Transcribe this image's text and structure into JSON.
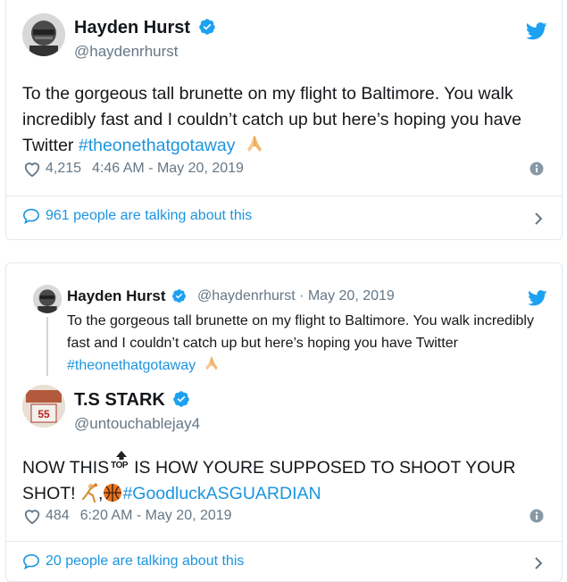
{
  "tweet1": {
    "display_name": "Hayden Hurst",
    "handle": "@haydenrhurst",
    "text_plain": "To the gorgeous tall brunette on my flight to Baltimore. You walk incredibly fast and I couldn’t catch up but here’s hoping you have Twitter ",
    "hashtag": "#theonethatgotaway",
    "likes": "4,215",
    "timestamp": "4:46 AM - May 20, 2019",
    "talking": "961 people are talking about this"
  },
  "quoted": {
    "display_name": "Hayden Hurst",
    "handle_date": "@haydenrhurst · May 20, 2019",
    "text_plain": "To the gorgeous tall brunette on my flight to Baltimore. You walk incredibly fast and I couldn’t catch up but here’s hoping you have Twitter ",
    "hashtag": "#theonethatgotaway"
  },
  "tweet2": {
    "display_name": "T.S STARK",
    "handle": "@untouchablejay4",
    "text_part1": "NOW THIS",
    "top_label": "TOP",
    "text_part2": "IS HOW YOURE SUPPOSED TO SHOOT YOUR SHOT! ",
    "hashtag": "#GoodluckASGUARDIAN",
    "likes": "484",
    "timestamp": "6:20 AM - May 20, 2019",
    "talking": "20 people are talking about this"
  },
  "colors": {
    "accent": "#1b95e0",
    "twitter_blue": "#1da1f2",
    "text": "#14171a",
    "muted": "#657786",
    "border": "#e1e8ed"
  },
  "icons": [
    "twitter-bird-icon",
    "verified-badge-icon",
    "heart-icon",
    "info-icon",
    "speech-bubble-icon",
    "chevron-right-icon",
    "praying-hands-emoji",
    "top-arrow-emoji",
    "basketball-player-emoji",
    "basketball-emoji"
  ]
}
